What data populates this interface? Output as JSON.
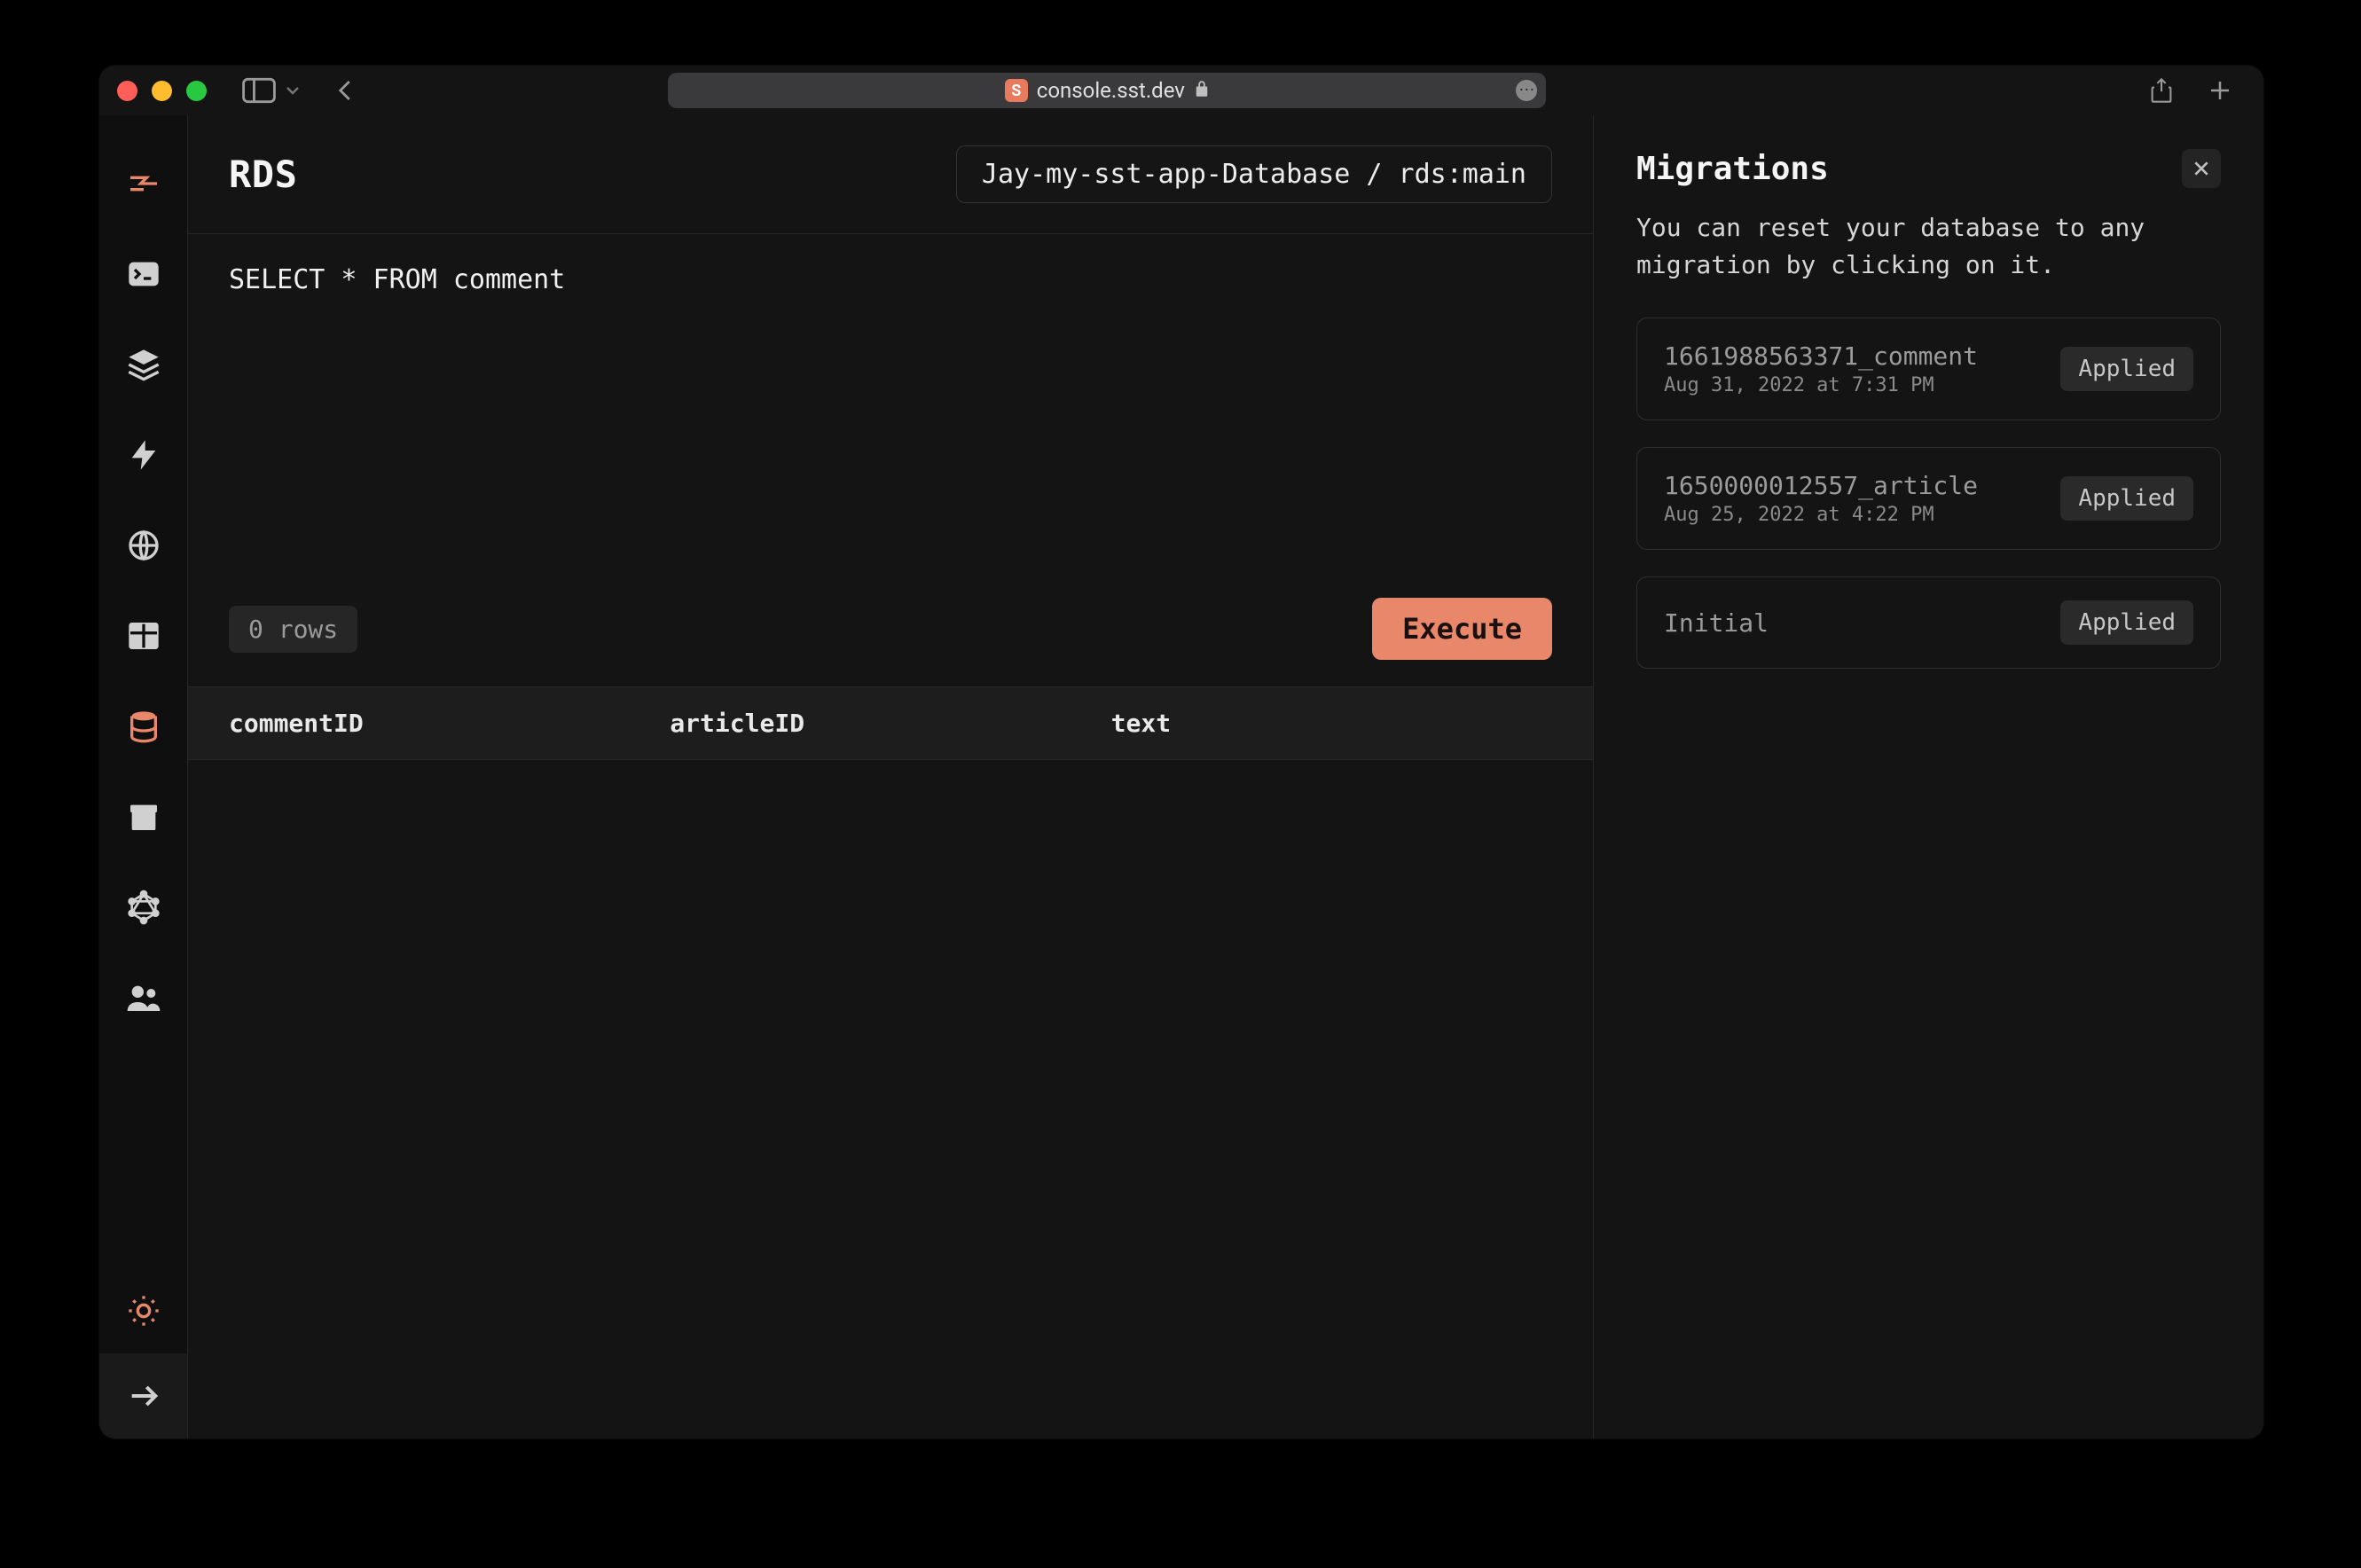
{
  "browser": {
    "url": "console.sst.dev"
  },
  "sidebar": {
    "items": [
      {
        "name": "logo"
      },
      {
        "name": "terminal"
      },
      {
        "name": "stacks"
      },
      {
        "name": "functions"
      },
      {
        "name": "api"
      },
      {
        "name": "tables"
      },
      {
        "name": "rds"
      },
      {
        "name": "buckets"
      },
      {
        "name": "graphql"
      },
      {
        "name": "auth"
      }
    ]
  },
  "header": {
    "title": "RDS",
    "db_selector": "Jay-my-sst-app-Database / rds:main"
  },
  "query": {
    "text": "SELECT * FROM comment",
    "rows_label": "0 rows",
    "execute_label": "Execute"
  },
  "results": {
    "columns": [
      "commentID",
      "articleID",
      "text"
    ],
    "rows": []
  },
  "migrations": {
    "title": "Migrations",
    "description": "You can reset your database to any migration by clicking on it.",
    "applied_label": "Applied",
    "items": [
      {
        "name": "1661988563371_comment",
        "date": "Aug 31, 2022 at 7:31 PM",
        "status": "Applied"
      },
      {
        "name": "1650000012557_article",
        "date": "Aug 25, 2022 at 4:22 PM",
        "status": "Applied"
      },
      {
        "name": "Initial",
        "date": "",
        "status": "Applied"
      }
    ]
  }
}
